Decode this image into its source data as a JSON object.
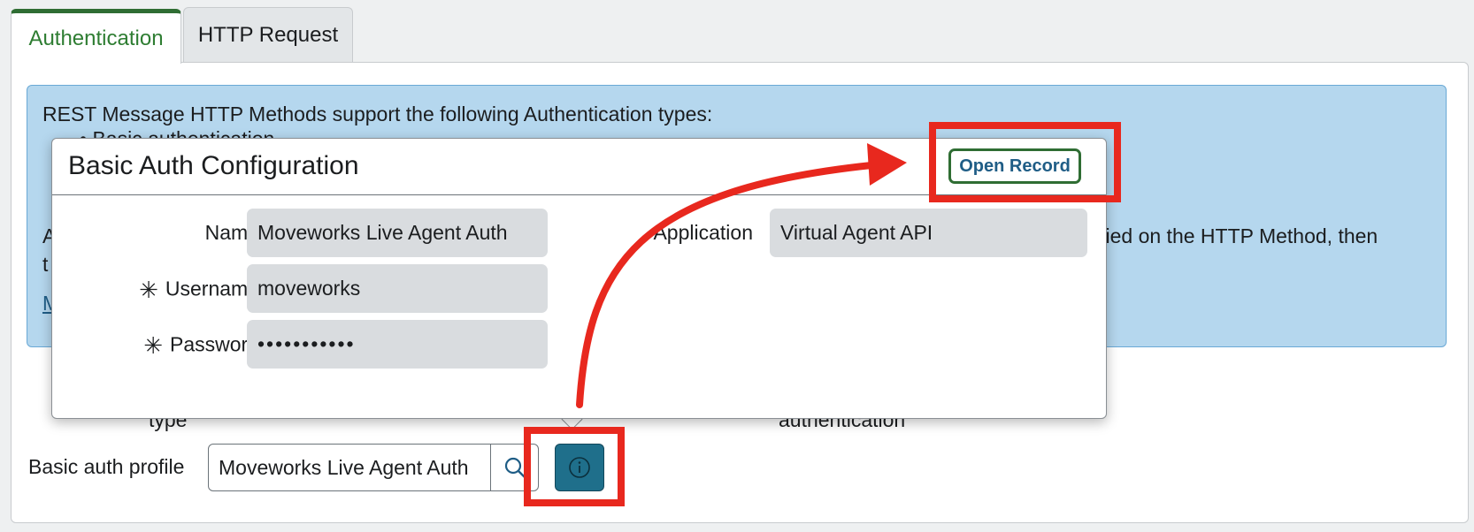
{
  "tabs": [
    {
      "label": "Authentication",
      "active": true
    },
    {
      "label": "HTTP Request",
      "active": false
    }
  ],
  "info": {
    "line1": "REST Message HTTP Methods support the following Authentication types:",
    "line2_partial": "• Basic authentication",
    "line3_start": "A",
    "line3_end": "ified on the HTTP Method, then",
    "line4_start": "t",
    "link_partial": "M"
  },
  "form": {
    "type_label_partial": "type",
    "authentication_partial": "authentication",
    "basic_auth_profile_label": "Basic auth profile",
    "basic_auth_profile_value": "Moveworks Live Agent Auth"
  },
  "popover": {
    "title": "Basic Auth Configuration",
    "open_record_label": "Open Record",
    "name_label": "Name",
    "name_value": "Moveworks Live Agent Auth",
    "username_label": "Username",
    "username_value": "moveworks",
    "password_label": "Password",
    "password_value": "•••••••••••",
    "application_label": "Application",
    "application_value": "Virtual Agent API",
    "required_marker": "✳"
  },
  "colors": {
    "accent_green": "#2f6d33",
    "info_bg": "#b5d7ee",
    "button_teal": "#1f6f8b",
    "annotation_red": "#e8281e"
  }
}
